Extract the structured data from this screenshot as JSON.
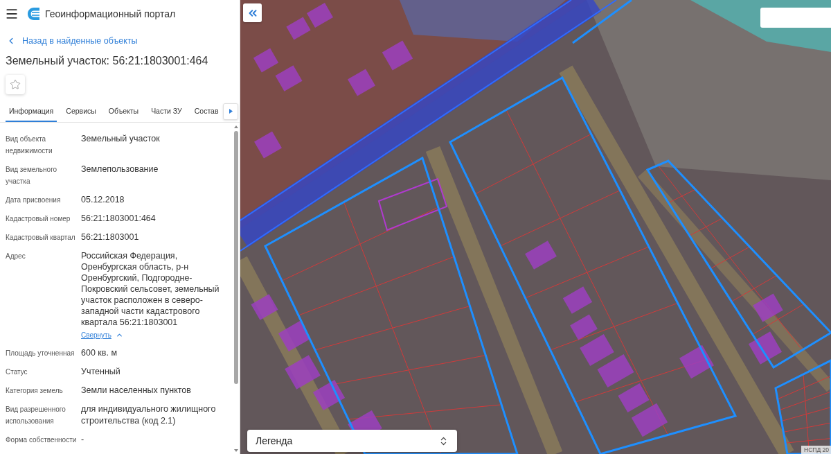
{
  "header": {
    "title": "Геоинформационный портал"
  },
  "back_link": {
    "label": "Назад в найденные объекты"
  },
  "object": {
    "title": "Земельный участок: 56:21:1803001:464"
  },
  "tabs": [
    {
      "label": "Информация",
      "selected": true
    },
    {
      "label": "Сервисы",
      "selected": false
    },
    {
      "label": "Объекты",
      "selected": false
    },
    {
      "label": "Части ЗУ",
      "selected": false
    },
    {
      "label": "Состав",
      "selected": false
    }
  ],
  "properties": [
    {
      "label": "Вид объекта недвижимости",
      "value": "Земельный участок"
    },
    {
      "label": "Вид земельного участка",
      "value": "Землепользование"
    },
    {
      "label": "Дата присвоения",
      "value": "05.12.2018"
    },
    {
      "label": "Кадастровый номер",
      "value": "56:21:1803001:464"
    },
    {
      "label": "Кадастровый квартал",
      "value": "56:21:1803001"
    },
    {
      "label": "Адрес",
      "value": "Российская Федерация, Оренбургская область, р-н Оренбургский, Подгородне-Покровский сельсовет, земельный участок расположен в северо-западной части кадастрового квартала 56:21:1803001",
      "toggle": {
        "label": "Свернуть",
        "expanded": true
      }
    },
    {
      "label": "Площадь уточненная",
      "value": "600 кв. м"
    },
    {
      "label": "Статус",
      "value": "Учтенный"
    },
    {
      "label": "Категория земель",
      "value": "Земли населенных пунктов"
    },
    {
      "label": "Вид разрешенного использования",
      "value": "для индивидуального жилищного строительства (код 2.1)"
    },
    {
      "label": "Форма собственности",
      "value": "-"
    }
  ],
  "map": {
    "legend": {
      "label": "Легенда"
    },
    "attribution": "НСПД 20"
  }
}
